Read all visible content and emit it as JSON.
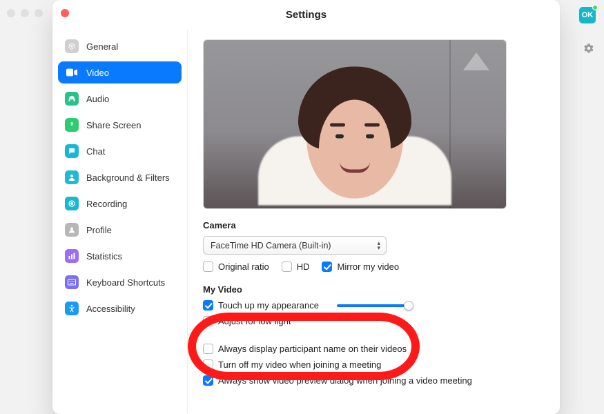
{
  "window": {
    "title": "Settings"
  },
  "avatar": {
    "initials": "OK"
  },
  "sidebar": {
    "items": [
      {
        "label": "General"
      },
      {
        "label": "Video"
      },
      {
        "label": "Audio"
      },
      {
        "label": "Share Screen"
      },
      {
        "label": "Chat"
      },
      {
        "label": "Background & Filters"
      },
      {
        "label": "Recording"
      },
      {
        "label": "Profile"
      },
      {
        "label": "Statistics"
      },
      {
        "label": "Keyboard Shortcuts"
      },
      {
        "label": "Accessibility"
      }
    ],
    "active_index": 1
  },
  "camera": {
    "section_label": "Camera",
    "selected": "FaceTime HD Camera (Built-in)",
    "opts": {
      "original_ratio": {
        "label": "Original ratio",
        "checked": false
      },
      "hd": {
        "label": "HD",
        "checked": false
      },
      "mirror": {
        "label": "Mirror my video",
        "checked": true
      }
    }
  },
  "my_video": {
    "section_label": "My Video",
    "touch_up": {
      "label": "Touch up my appearance",
      "checked": true
    },
    "low_light": {
      "label": "Adjust for low light",
      "checked": false
    }
  },
  "other": {
    "display_name": {
      "label": "Always display participant name on their videos",
      "checked": false
    },
    "turn_off_join": {
      "label": "Turn off my video when joining a meeting",
      "checked": false
    },
    "preview_dialog": {
      "label": "Always show video preview dialog when joining a video meeting",
      "checked": true
    }
  },
  "icon_colors": {
    "general": "#cfcfcf",
    "video": "#ffffff",
    "audio": "#27c28a",
    "share": "#2ecc71",
    "chat": "#17b8d4",
    "bg": "#1fbad6",
    "recording": "#17b8d4",
    "profile": "#b7b7b7",
    "stats": "#9b6ef3",
    "keyboard": "#7c6ef2",
    "accessibility": "#1a9bf0"
  }
}
